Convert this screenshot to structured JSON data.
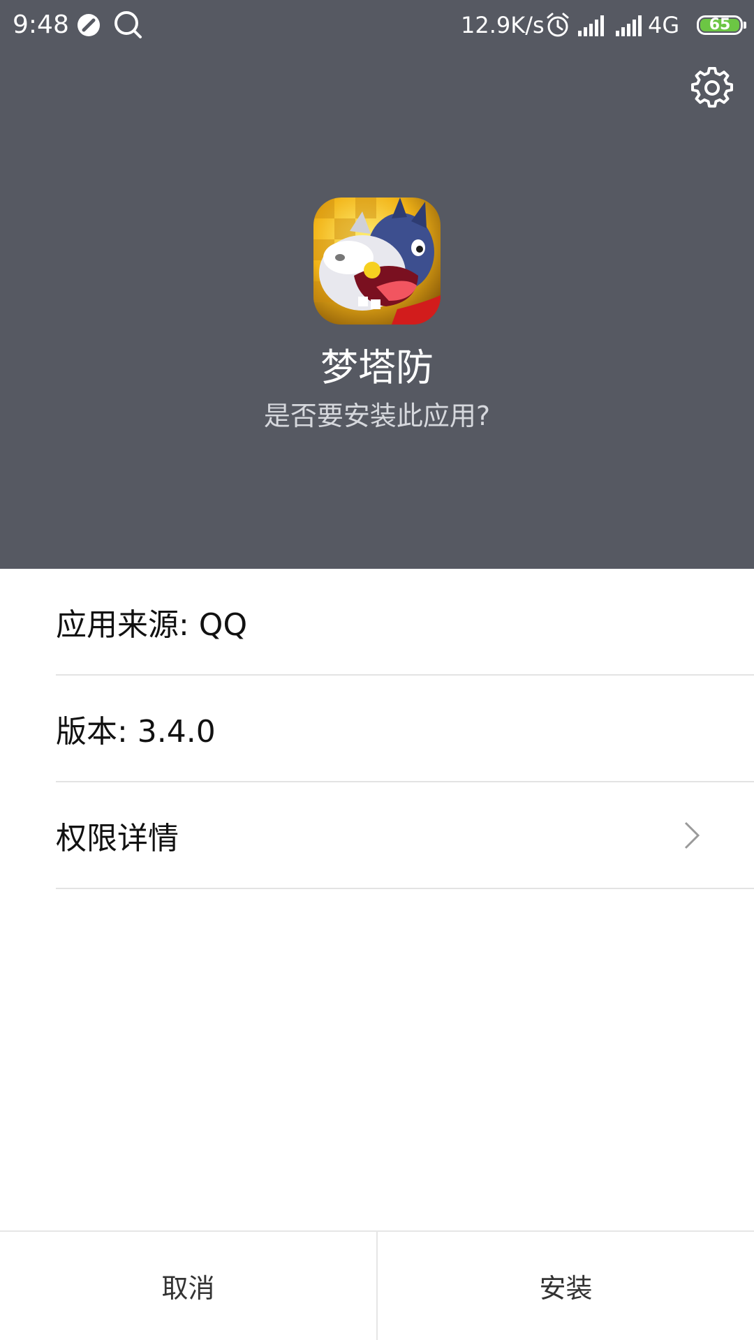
{
  "status_bar": {
    "time": "9:48",
    "net_speed": "12.9K/s",
    "network_type": "4G",
    "battery_level": "65",
    "icons": [
      "no-disturb-icon",
      "search-icon",
      "alarm-icon",
      "signal-icon",
      "signal-icon",
      "battery-icon"
    ]
  },
  "header": {
    "settings_icon": "gear-icon",
    "app_name": "梦塔防",
    "question": "是否要安装此应用?",
    "background_color": "#565962"
  },
  "info": {
    "source": "应用来源: QQ",
    "version": "版本: 3.4.0",
    "permissions": "权限详情",
    "permissions_icon": "chevron-right-icon"
  },
  "actions": {
    "cancel": "取消",
    "install": "安装"
  },
  "colors": {
    "battery_fill": "#6cc644",
    "divider": "#e3e3e3"
  }
}
